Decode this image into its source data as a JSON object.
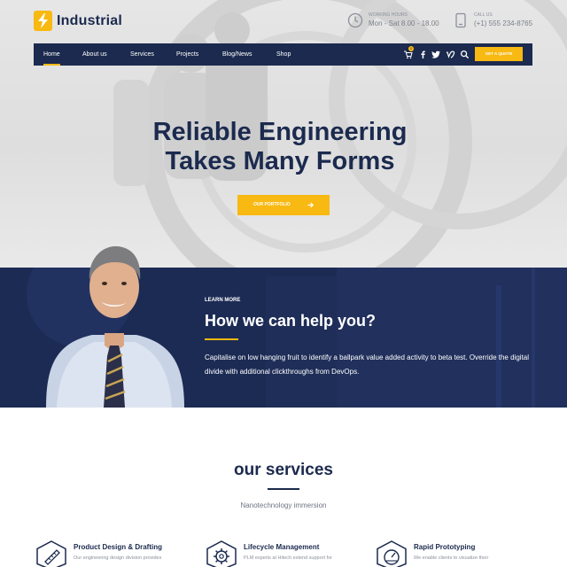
{
  "brand": {
    "name": "Industrial"
  },
  "header": {
    "hours": {
      "label": "WORKING HOURS",
      "value": "Mon - Sat 8.00 - 18.00"
    },
    "phone": {
      "label": "CALL US",
      "value": "(+1) 555 234-8765"
    }
  },
  "nav": {
    "items": [
      "Home",
      "About us",
      "Services",
      "Projects",
      "Blog/News",
      "Shop"
    ],
    "active_item": "Home",
    "cart_count": "0",
    "quote_label": "GET A QUOTE",
    "icons": [
      "cart-icon",
      "facebook-icon",
      "twitter-icon",
      "vimeo-icon",
      "search-icon"
    ]
  },
  "hero": {
    "headline_line1": "Reliable Engineering",
    "headline_line2": "Takes Many Forms",
    "button_label": "OUR PORTFOLIO"
  },
  "help": {
    "eyebrow": "LEARN MORE",
    "title": "How we can help you?",
    "text": "Capitalise on low hanging fruit to identify a ballpark value added activity to beta test. Override the digital divide with additional clickthroughs from DevOps."
  },
  "services": {
    "title": "our services",
    "subtitle": "Nanotechnology immersion",
    "items": [
      {
        "title": "Product Design & Drafting",
        "text": "Our engineering design division provides",
        "icon": "ruler-icon"
      },
      {
        "title": "Lifecycle Management",
        "text": "PLM experts at Hitech extend support for",
        "icon": "gear-icon"
      },
      {
        "title": "Rapid Prototyping",
        "text": "We enable clients to visualize their",
        "icon": "gauge-icon"
      }
    ]
  },
  "colors": {
    "accent": "#f7b912",
    "navy": "#1b2a4e",
    "band": "#1c2b54"
  }
}
